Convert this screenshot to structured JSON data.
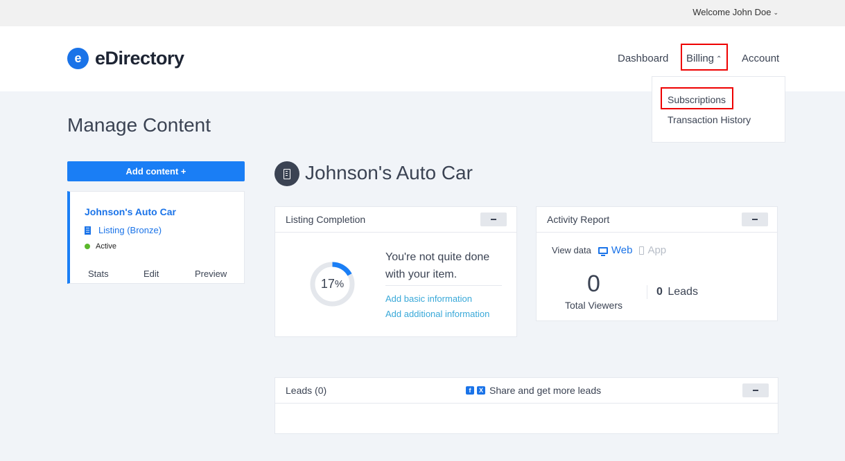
{
  "topbar": {
    "welcome": "Welcome John Doe"
  },
  "header": {
    "logo_letter": "e",
    "logo_text": "eDirectory",
    "nav": {
      "dashboard": "Dashboard",
      "billing": "Billing",
      "account": "Account"
    }
  },
  "billing_menu": {
    "subscriptions": "Subscriptions",
    "transaction_history": "Transaction History"
  },
  "page": {
    "title": "Manage Content"
  },
  "sidebar": {
    "add_button": "Add content +",
    "card": {
      "title": "Johnson's Auto Car",
      "type": "Listing (Bronze)",
      "status": "Active",
      "actions": {
        "stats": "Stats",
        "edit": "Edit",
        "preview": "Preview"
      }
    }
  },
  "listing": {
    "name": "Johnson's Auto Car"
  },
  "completion": {
    "title": "Listing Completion",
    "percent": 17,
    "percent_value": "17",
    "percent_sign": "%",
    "message": "You're not quite done with your item.",
    "links": {
      "basic": "Add basic information",
      "additional": "Add additional information"
    }
  },
  "activity": {
    "title": "Activity Report",
    "view_data_label": "View data",
    "web": "Web",
    "app": "App",
    "viewers_count": "0",
    "viewers_label": "Total Viewers",
    "leads_count": "0",
    "leads_label": "Leads"
  },
  "leads_panel": {
    "title": "Leads (0)",
    "share_text": "Share and get more leads"
  },
  "colors": {
    "accent": "#1a7ef5",
    "link": "#38a8d8",
    "highlight": "#ee0000",
    "active": "#5bb82c"
  }
}
